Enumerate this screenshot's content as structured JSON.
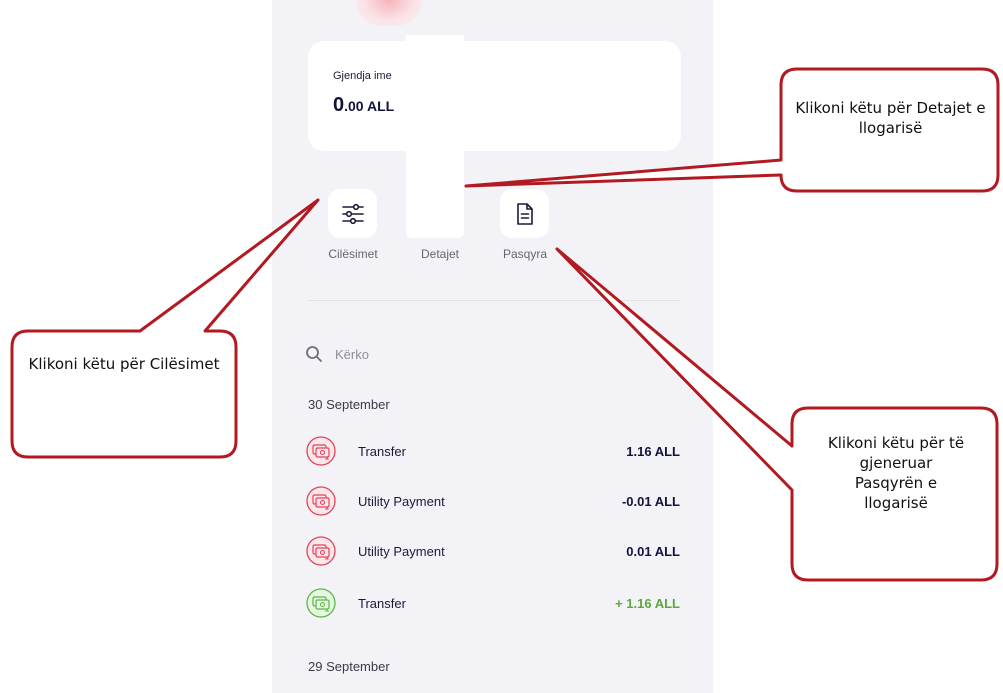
{
  "balance": {
    "label": "Gjendja ime",
    "amount_int": "0",
    "amount_dec": ".00 ALL"
  },
  "actions": [
    {
      "label": "Cilësimet",
      "icon": "sliders-icon"
    },
    {
      "label": "Detajet",
      "icon": "details-icon"
    },
    {
      "label": "Pasqyra",
      "icon": "document-icon"
    }
  ],
  "search": {
    "placeholder": "Kërko",
    "icon": "search-icon"
  },
  "groups": [
    {
      "date": "30 September",
      "transactions": [
        {
          "name": "Transfer",
          "amount": "1.16 ALL",
          "type": "outgoing"
        },
        {
          "name": "Utility Payment",
          "amount": "-0.01 ALL",
          "type": "outgoing"
        },
        {
          "name": "Utility Payment",
          "amount": "0.01 ALL",
          "type": "outgoing"
        },
        {
          "name": "Transfer",
          "amount": "+ 1.16 ALL",
          "type": "incoming"
        }
      ]
    },
    {
      "date": "29 September",
      "transactions": []
    }
  ],
  "callouts": {
    "settings": "Klikoni këtu për Cilësimet",
    "details": "Klikoni këtu për Detajet e llogarisë",
    "statement": "Klikoni këtu për të gjeneruar Pasqyrën e llogarisë"
  },
  "colors": {
    "outgoing_icon": "#e0435a",
    "incoming_icon": "#5ab845",
    "positive_amount": "#5ca83a",
    "callout_border": "#b11a21"
  }
}
